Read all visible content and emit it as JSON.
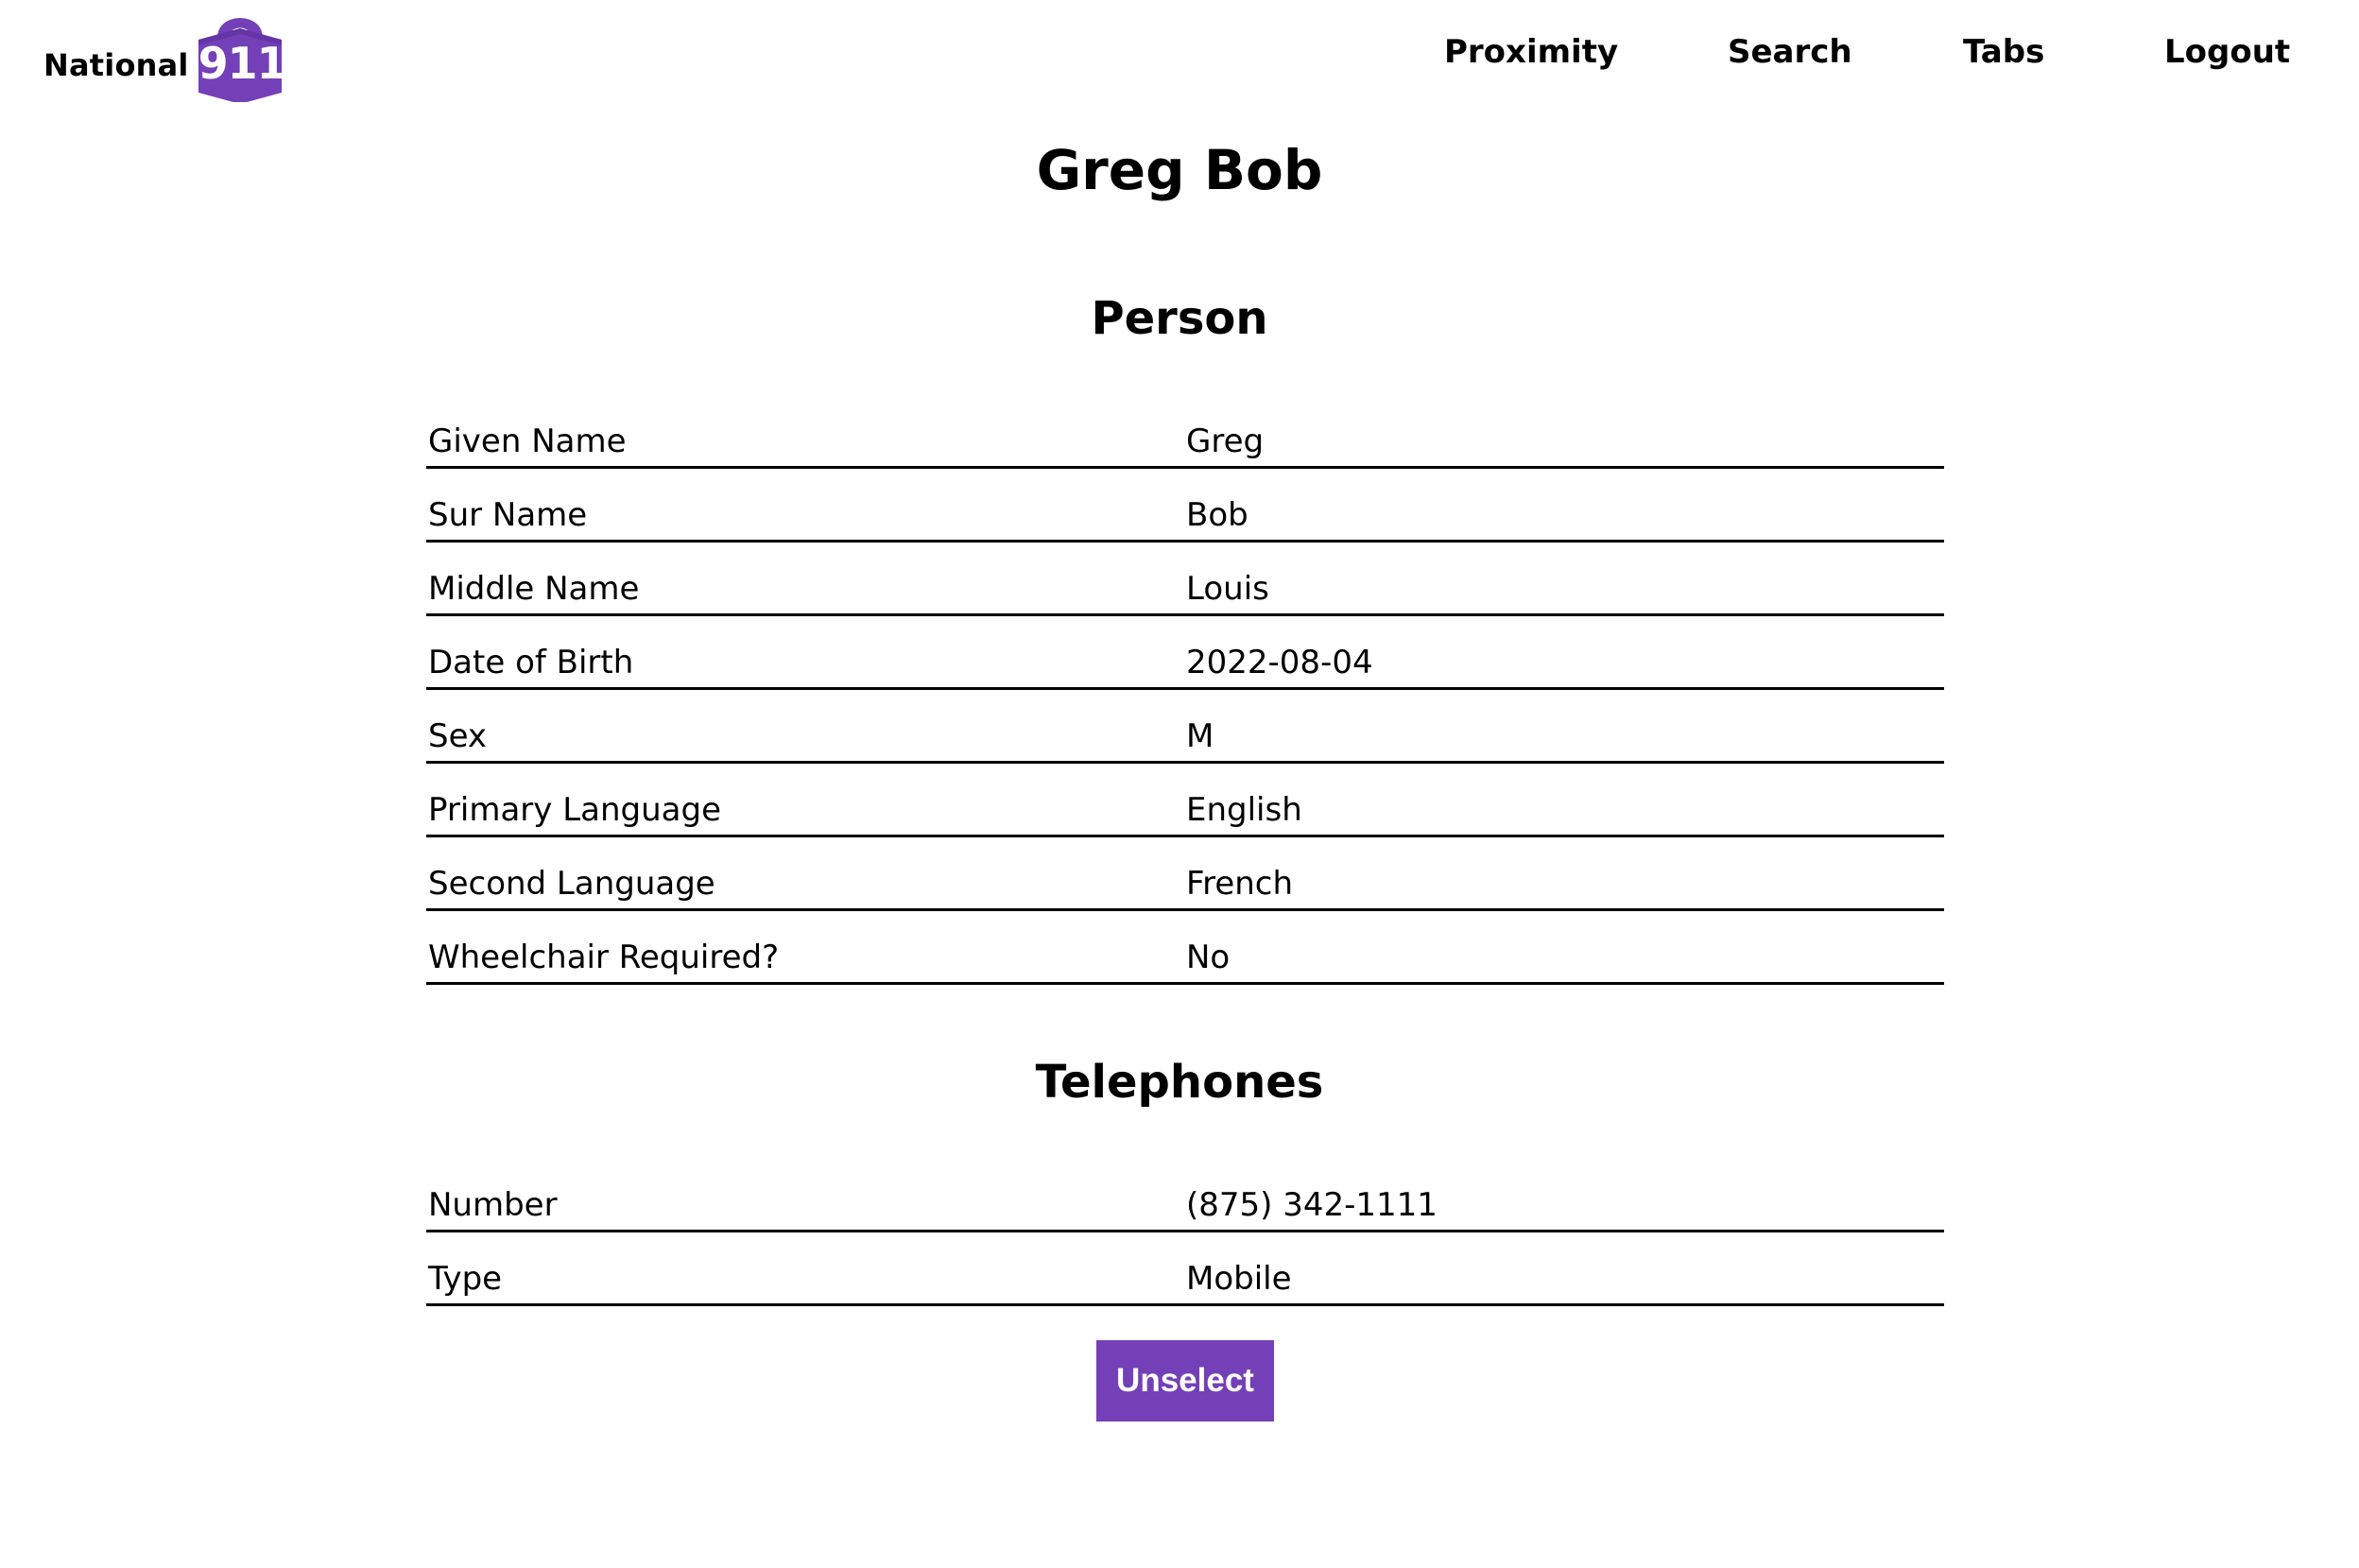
{
  "colors": {
    "accent": "#7440b7",
    "text": "#000000",
    "background": "#ffffff"
  },
  "brand": {
    "name": "National",
    "number": "911",
    "icon": "lock-badge-icon"
  },
  "nav": {
    "items": [
      {
        "label": "Proximity"
      },
      {
        "label": "Search"
      },
      {
        "label": "Tabs"
      },
      {
        "label": "Logout"
      }
    ]
  },
  "page": {
    "title": "Greg Bob"
  },
  "person": {
    "title": "Person",
    "rows": [
      {
        "label": "Given Name",
        "value": "Greg"
      },
      {
        "label": "Sur Name",
        "value": "Bob"
      },
      {
        "label": "Middle Name",
        "value": "Louis"
      },
      {
        "label": "Date of Birth",
        "value": "2022-08-04"
      },
      {
        "label": "Sex",
        "value": "M"
      },
      {
        "label": "Primary Language",
        "value": "English"
      },
      {
        "label": "Second Language",
        "value": "French"
      },
      {
        "label": "Wheelchair Required?",
        "value": "No"
      }
    ]
  },
  "telephones": {
    "title": "Telephones",
    "rows": [
      {
        "label": "Number",
        "value": "(875) 342-1111"
      },
      {
        "label": "Type",
        "value": "Mobile"
      }
    ]
  },
  "actions": {
    "unselect_label": "Unselect"
  }
}
